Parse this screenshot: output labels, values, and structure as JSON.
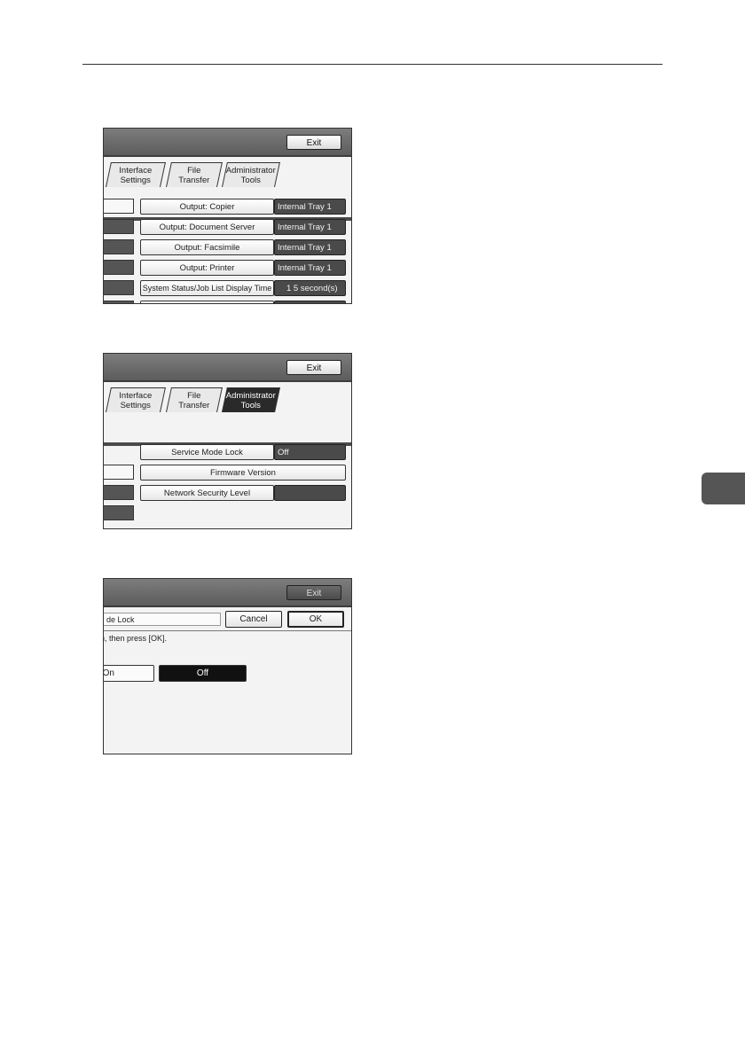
{
  "exit_label": "Exit",
  "tabs": {
    "interface_settings": "Interface\nSettings",
    "file_transfer": "File\nTransfer",
    "administrator_tools": "Administrator\nTools"
  },
  "screen1": {
    "rows": [
      {
        "label": "Output: Copier",
        "value": "Internal Tray 1"
      },
      {
        "label": "Output: Document Server",
        "value": "Internal Tray 1"
      },
      {
        "label": "Output: Facsimile",
        "value": "Internal Tray 1"
      },
      {
        "label": "Output: Printer",
        "value": "Internal Tray 1"
      },
      {
        "label": "System Status/Job List Display Time",
        "value": "1 5 second(s)"
      }
    ]
  },
  "screen2": {
    "service_mode_lock_label": "Service Mode Lock",
    "service_mode_lock_value": "Off",
    "firmware_version_label": "Firmware Version",
    "network_security_level_label": "Network Security Level",
    "network_security_level_value": ""
  },
  "screen3": {
    "setting_label": "de Lock",
    "cancel_label": "Cancel",
    "ok_label": "OK",
    "instruction": "n, then press [OK].",
    "on_label": "On",
    "off_label": "Off"
  },
  "colors": {
    "titlebar": "#666666",
    "value_field": "#4a4a4a",
    "selected": "#111111"
  }
}
